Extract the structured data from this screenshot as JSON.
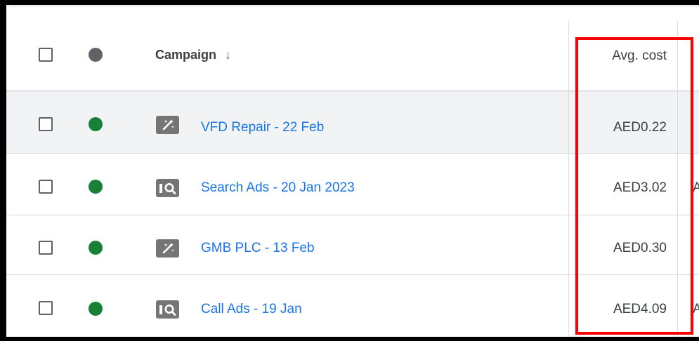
{
  "header": {
    "campaign_label": "Campaign",
    "sort_icon": "arrow-down-icon",
    "avg_cost_label": "Avg. cost"
  },
  "colors": {
    "status_enabled": "#188038",
    "status_header": "#5f6368",
    "link": "#1a73e8",
    "highlight": "#ff0000"
  },
  "rows": [
    {
      "status": "enabled",
      "type_icon": "smart-campaign-icon",
      "name": "VFD Repair - 22 Feb",
      "avg_cost": "AED0.22",
      "next_col_partial": ""
    },
    {
      "status": "enabled",
      "type_icon": "search-campaign-icon",
      "name": "Search Ads - 20 Jan 2023",
      "avg_cost": "AED3.02",
      "next_col_partial": "A"
    },
    {
      "status": "enabled",
      "type_icon": "smart-campaign-icon",
      "name": "GMB PLC - 13 Feb",
      "avg_cost": "AED0.30",
      "next_col_partial": ""
    },
    {
      "status": "enabled",
      "type_icon": "search-campaign-icon",
      "name": "Call Ads - 19 Jan",
      "avg_cost": "AED4.09",
      "next_col_partial": "A"
    }
  ]
}
